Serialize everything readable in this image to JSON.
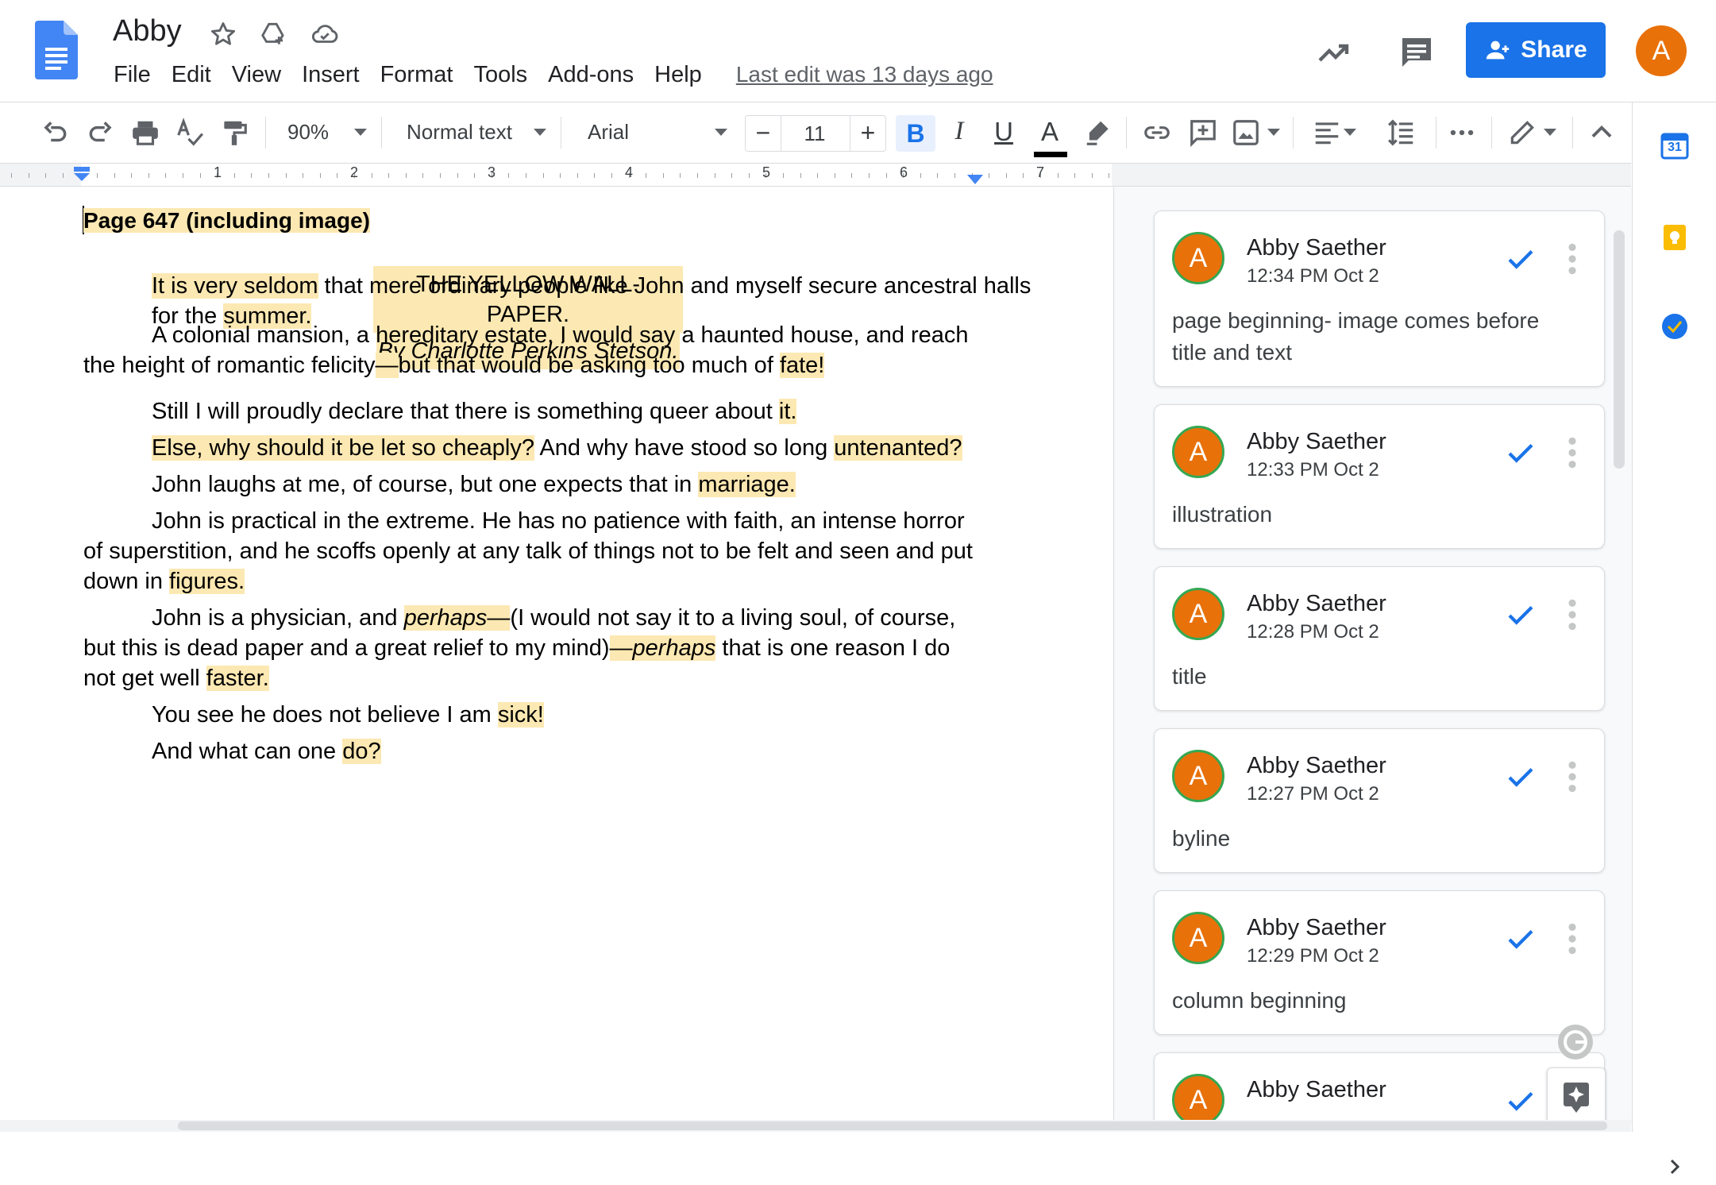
{
  "app": {
    "doc_title": "Abby",
    "menu": [
      "File",
      "Edit",
      "View",
      "Insert",
      "Format",
      "Tools",
      "Add-ons",
      "Help"
    ],
    "last_edit": "Last edit was 13 days ago",
    "share_label": "Share",
    "user_initial": "A"
  },
  "toolbar": {
    "zoom": "90%",
    "style": "Normal text",
    "font": "Arial",
    "font_size": "11",
    "minus": "−",
    "plus": "+",
    "bold": "B",
    "italic": "I",
    "underline": "U",
    "text_color_letter": "A"
  },
  "ruler": {
    "numbers": [
      "1",
      "2",
      "3",
      "4",
      "5",
      "6",
      "7"
    ]
  },
  "document": {
    "page_label": "Page 647 (including image)",
    "title": "THE YELLOW WALL-PAPER.",
    "byline": "By Charlotte Perkins Stetson.",
    "p1": {
      "a": "It is very seldom",
      "b": " that mere ordinary people like John and myself secure ancestral halls for the ",
      "c": "summer."
    },
    "p2": {
      "a": "A colonial mansion, a hereditary estate, I would say a haunted house, and reach the height of romantic felicity",
      "b": "—",
      "c": "but that would be asking too much of ",
      "d": "fate!"
    },
    "p3": {
      "a": "Still I will proudly declare that there is something queer about ",
      "b": "it."
    },
    "p4": {
      "a": "Else, why should it be let so cheaply?",
      "b": " And why have stood so long ",
      "c": "untenanted?"
    },
    "p5": {
      "a": "John laughs at me, of course, but one expects that in ",
      "b": "marriage."
    },
    "p6": {
      "a": "John is practical in the extreme. He has no patience with faith, an intense horror of superstition, and he scoffs openly at any talk of things not to be felt and seen and put down in ",
      "b": "figures."
    },
    "p7": {
      "a": "John is a physician, and ",
      "b": "perhaps",
      "c": "—",
      "d": "(I would not say it to a living soul, of course, but this is dead paper and a great relief to my mind)",
      "e": "—",
      "f": "perhaps",
      "g": " that is one reason I do not get well ",
      "h": "faster."
    },
    "p8": {
      "a": "You see he does not believe I am ",
      "b": "sick!"
    },
    "p9": {
      "a": "And what can one ",
      "b": "do?"
    }
  },
  "comments": [
    {
      "author": "Abby Saether",
      "time": "12:34 PM Oct 2",
      "text": "page beginning- image comes before title and text",
      "initial": "A"
    },
    {
      "author": "Abby Saether",
      "time": "12:33 PM Oct 2",
      "text": "illustration",
      "initial": "A"
    },
    {
      "author": "Abby Saether",
      "time": "12:28 PM Oct 2",
      "text": "title",
      "initial": "A"
    },
    {
      "author": "Abby Saether",
      "time": "12:27 PM Oct 2",
      "text": "byline",
      "initial": "A"
    },
    {
      "author": "Abby Saether",
      "time": "12:29 PM Oct 2",
      "text": "column beginning",
      "initial": "A"
    },
    {
      "author": "Abby Saether",
      "initial": "A"
    }
  ],
  "colors": {
    "accent": "#1a73e8",
    "highlight": "#fce8b2",
    "avatar": "#e8710a",
    "avatar_ring": "#34a853"
  },
  "icons": {
    "side_calendar_label": "31"
  }
}
